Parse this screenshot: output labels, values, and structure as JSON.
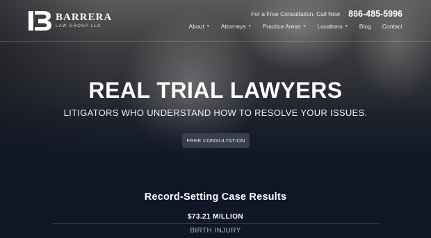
{
  "brand": {
    "name": "BARRERA",
    "subtitle": "LAW GROUP LLC"
  },
  "header": {
    "call_label": "For a Free Consultation, Call Now",
    "phone": "866-485-5996"
  },
  "nav": {
    "about": "About",
    "attorneys": "Attorneys",
    "practice_areas": "Practice Areas",
    "locations": "Locations",
    "blog": "Blog",
    "contact": "Contact"
  },
  "hero": {
    "headline": "REAL TRIAL LAWYERS",
    "subheadline": "LITIGATORS WHO UNDERSTAND HOW TO RESOLVE YOUR ISSUES.",
    "cta_label": "FREE CONSULTATION"
  },
  "results": {
    "title": "Record-Setting Case Results",
    "amount": "$73.21 MILLION",
    "type": "BIRTH INJURY"
  },
  "colors": {
    "accent_rule": "#8b2230",
    "background": "#0f1626"
  }
}
